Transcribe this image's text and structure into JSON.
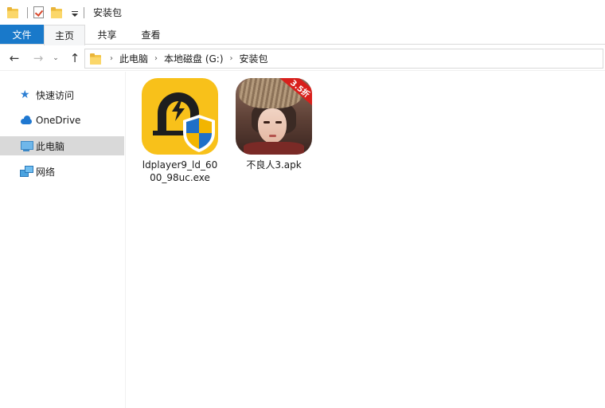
{
  "window": {
    "title": "安装包"
  },
  "ribbon": {
    "tabs": [
      "文件",
      "主页",
      "共享",
      "查看"
    ],
    "active_tab": "主页"
  },
  "nav": {
    "back_glyph": "←",
    "forward_glyph": "→",
    "recent_glyph": "⌄",
    "up_glyph": "↑",
    "breadcrumb_separator": "›"
  },
  "address": {
    "path": [
      "此电脑",
      "本地磁盘 (G:)",
      "安装包"
    ]
  },
  "sidebar": {
    "items": [
      {
        "label": "快速访问",
        "icon": "star-icon",
        "selected": false
      },
      {
        "label": "OneDrive",
        "icon": "cloud-icon",
        "selected": false
      },
      {
        "label": "此电脑",
        "icon": "computer-icon",
        "selected": true
      },
      {
        "label": "网络",
        "icon": "network-icon",
        "selected": false
      }
    ]
  },
  "files": [
    {
      "name": "ldplayer9_ld_6000_98uc.exe",
      "icon": "ldplayer-app-icon"
    },
    {
      "name": "不良人3.apk",
      "icon": "game-app-icon",
      "badge": "3.5折"
    }
  ],
  "colors": {
    "file_tab_bg": "#1979ca",
    "selected_sidebar_bg": "#d9d9d9",
    "folder_yellow": "#f3c64a",
    "ldplayer_yellow": "#f8c11a",
    "badge_red": "#d8201c"
  }
}
